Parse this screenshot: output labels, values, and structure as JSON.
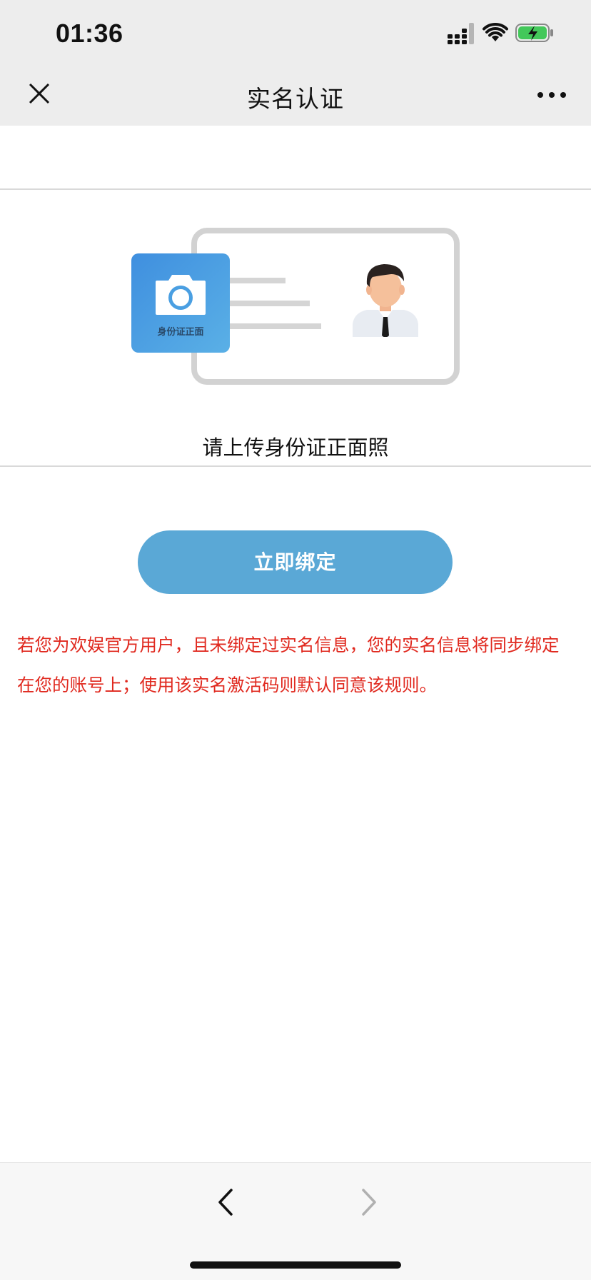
{
  "status_bar": {
    "time": "01:36",
    "icons": [
      "signal-icon",
      "wifi-icon",
      "battery-charging-icon"
    ]
  },
  "nav": {
    "title": "实名认证",
    "left_icon": "close-icon",
    "right_icon": "more-icon"
  },
  "upload": {
    "card_label": "身份证正面",
    "prompt": "请上传身份证正面照",
    "icons": [
      "camera-icon",
      "person-avatar-icon"
    ]
  },
  "bind_button": {
    "label": "立即绑定"
  },
  "notice": {
    "text": "若您为欢娱官方用户，且未绑定过实名信息，您的实名信息将同步绑定在您的账号上；使用该实名激活码则默认同意该规则。"
  },
  "colors": {
    "notice": "#e0281e",
    "button": "#5aa8d6",
    "camera_tile": "#4a9fe2",
    "nav_bg": "#ededed"
  },
  "bottom_bar": {
    "icons": [
      "back-chevron-icon",
      "forward-chevron-icon"
    ],
    "forward_disabled": true
  }
}
